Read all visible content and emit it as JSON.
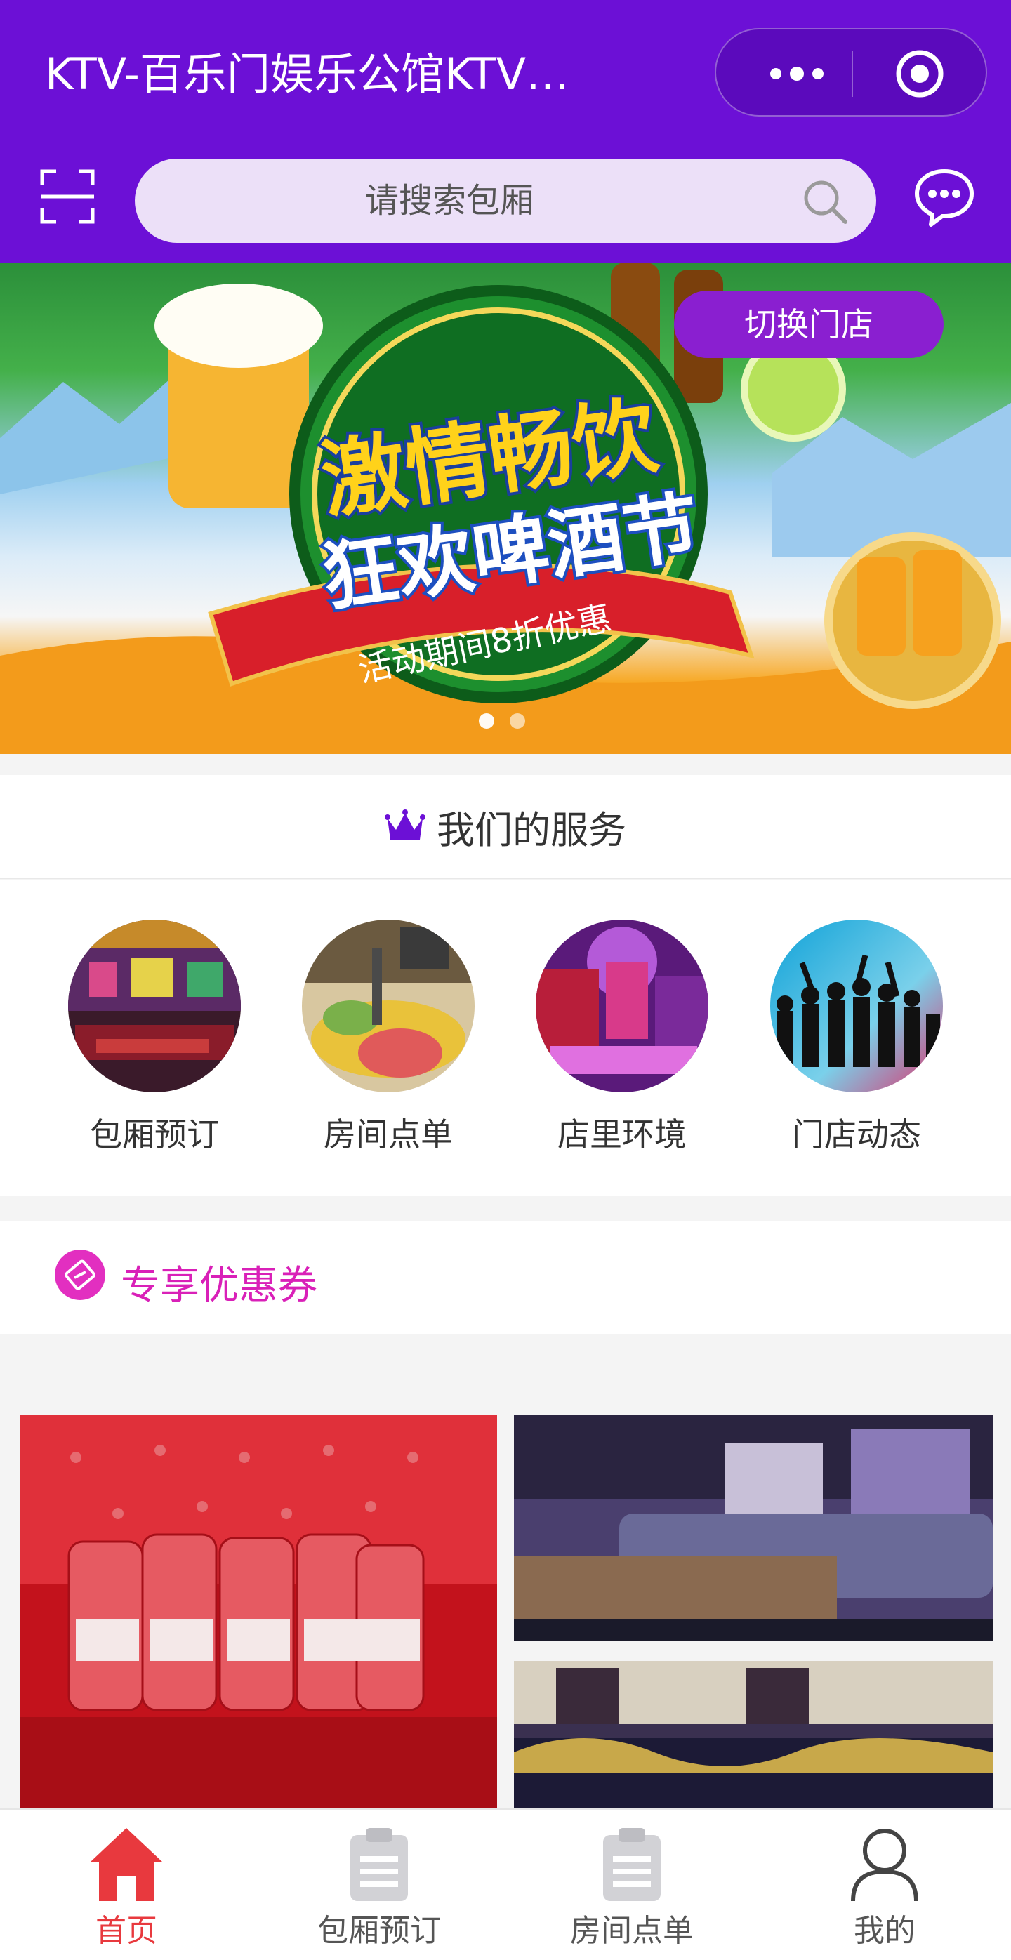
{
  "header": {
    "title": "KTV-百乐门娱乐公馆KTV…",
    "search_placeholder": "请搜索包厢"
  },
  "banner": {
    "headline_line1": "激情畅饮",
    "headline_line2": "狂欢啤酒节",
    "ribbon_text": "活动期间8折优惠",
    "switch_store_label": "切换门店",
    "slide_count": 2,
    "active_slide": 1
  },
  "services": {
    "title": "我们的服务",
    "items": [
      {
        "label": "包厢预订",
        "icon": "room-photo"
      },
      {
        "label": "房间点单",
        "icon": "food-photo"
      },
      {
        "label": "店里环境",
        "icon": "interior-photo"
      },
      {
        "label": "门店动态",
        "icon": "party-photo"
      }
    ]
  },
  "coupons": {
    "title": "专享优惠券"
  },
  "tabbar": {
    "items": [
      {
        "label": "首页",
        "icon": "home-icon",
        "active": true
      },
      {
        "label": "包厢预订",
        "icon": "clipboard-icon",
        "active": false
      },
      {
        "label": "房间点单",
        "icon": "clipboard-icon",
        "active": false
      },
      {
        "label": "我的",
        "icon": "user-icon",
        "active": false
      }
    ]
  },
  "colors": {
    "header_bg": "#6c10d6",
    "accent_purple": "#8a1fd0",
    "coupon_pink": "#d920b8",
    "tab_active_red": "#e8393e"
  }
}
